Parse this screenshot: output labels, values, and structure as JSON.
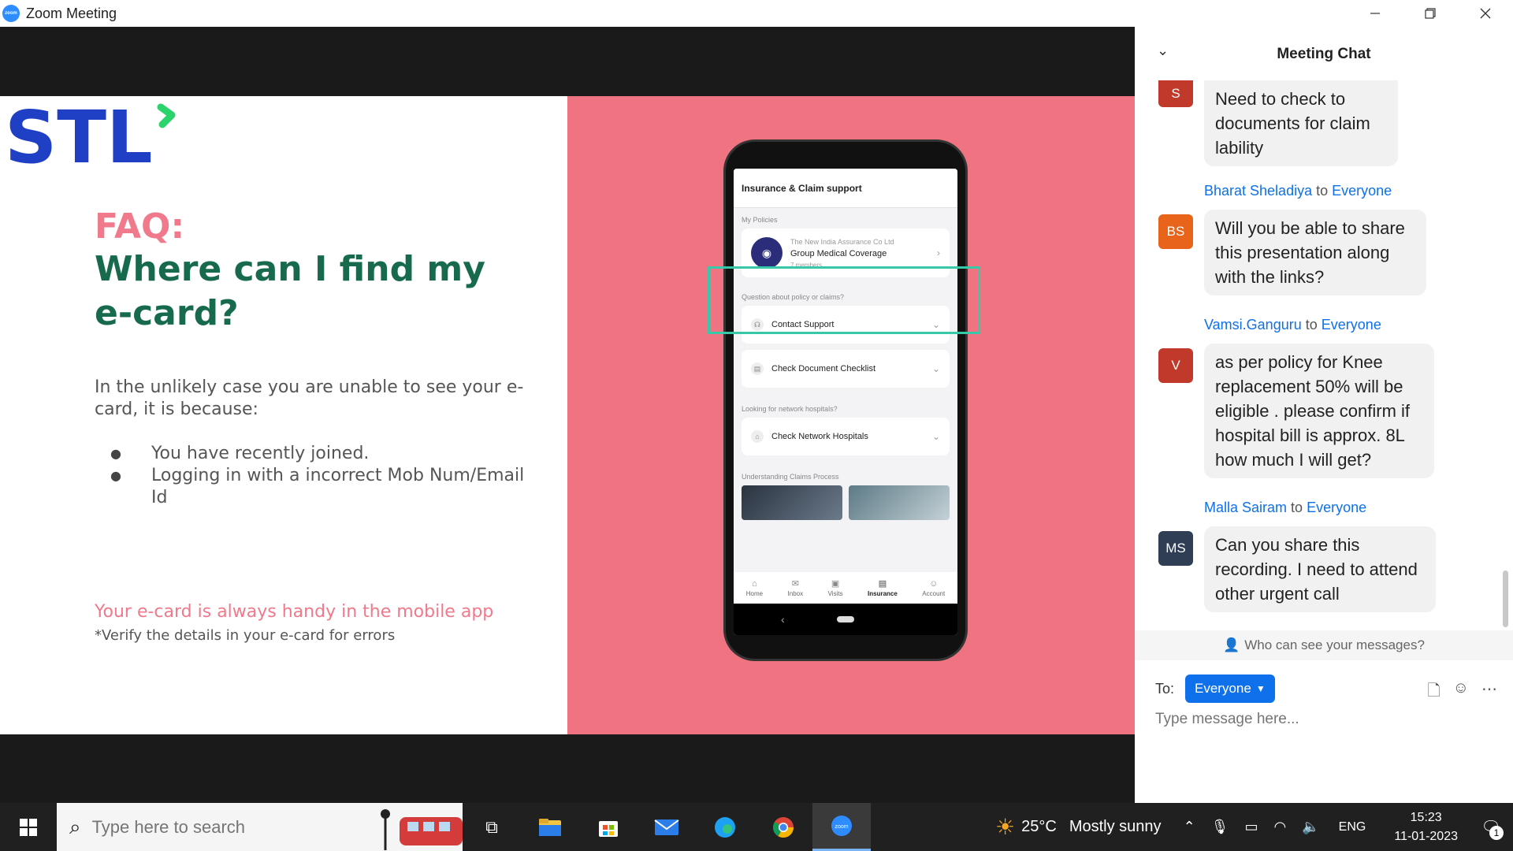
{
  "window": {
    "title": "Zoom Meeting",
    "app_logo_text": "zoom"
  },
  "slide": {
    "logo_text": "STL",
    "faq_label": "FAQ:",
    "faq_question": "Where can I find my e-card?",
    "intro": "In the unlikely case you are unable to see your e-card, it is because:",
    "bullets": [
      "You have recently joined.",
      "Logging in with a incorrect Mob Num/Email Id"
    ],
    "handy_line": "Your e-card is always handy in the mobile app",
    "verify_line": "*Verify the details in your e-card for errors",
    "colors": {
      "pink": "#f07382",
      "green": "#176b4c",
      "highlight": "#36c8a8",
      "logo_blue": "#1f3fc4",
      "logo_green": "#2bd46a"
    }
  },
  "phone": {
    "header": "Insurance & Claim support",
    "section_policies": "My Policies",
    "policy": {
      "insurer": "The New India Assurance Co Ltd",
      "name": "Group Medical Coverage",
      "members": "7 members"
    },
    "section_questions": "Question about policy or claims?",
    "items": [
      "Contact Support",
      "Check Document Checklist"
    ],
    "section_network": "Looking for network hospitals?",
    "network_item": "Check Network Hospitals",
    "section_claims": "Understanding Claims Process",
    "nav": [
      "Home",
      "Inbox",
      "Visits",
      "Insurance",
      "Account"
    ],
    "nav_active": "Insurance"
  },
  "chat": {
    "title": "Meeting Chat",
    "messages": [
      {
        "avatar": "S",
        "avatar_color": "#c0392b",
        "sender": "",
        "recipient": "",
        "text": "Need to check to documents for claim lability"
      },
      {
        "avatar": "BS",
        "avatar_color": "#e8641b",
        "sender": "Bharat Sheladiya",
        "recipient": "Everyone",
        "text": "Will you be able to share this presentation along with the links?"
      },
      {
        "avatar": "V",
        "avatar_color": "#c0392b",
        "sender": "Vamsi.Ganguru",
        "recipient": "Everyone",
        "text": "as per policy for Knee replacement 50% will be eligible . please confirm if hospital bill is approx. 8L how much I will get?"
      },
      {
        "avatar": "MS",
        "avatar_color": "#2f3e55",
        "sender": "Malla Sairam",
        "recipient": "Everyone",
        "text": "Can you share this recording. I need to attend other urgent call"
      }
    ],
    "to_word": "to",
    "who_can_see": "Who can see your messages?",
    "to_label": "To:",
    "to_value": "Everyone",
    "input_placeholder": "Type message here..."
  },
  "taskbar": {
    "search_placeholder": "Type here to search",
    "weather_temp": "25°C",
    "weather_desc": "Mostly sunny",
    "language": "ENG",
    "time": "15:23",
    "date": "11-01-2023",
    "notification_count": "1"
  }
}
